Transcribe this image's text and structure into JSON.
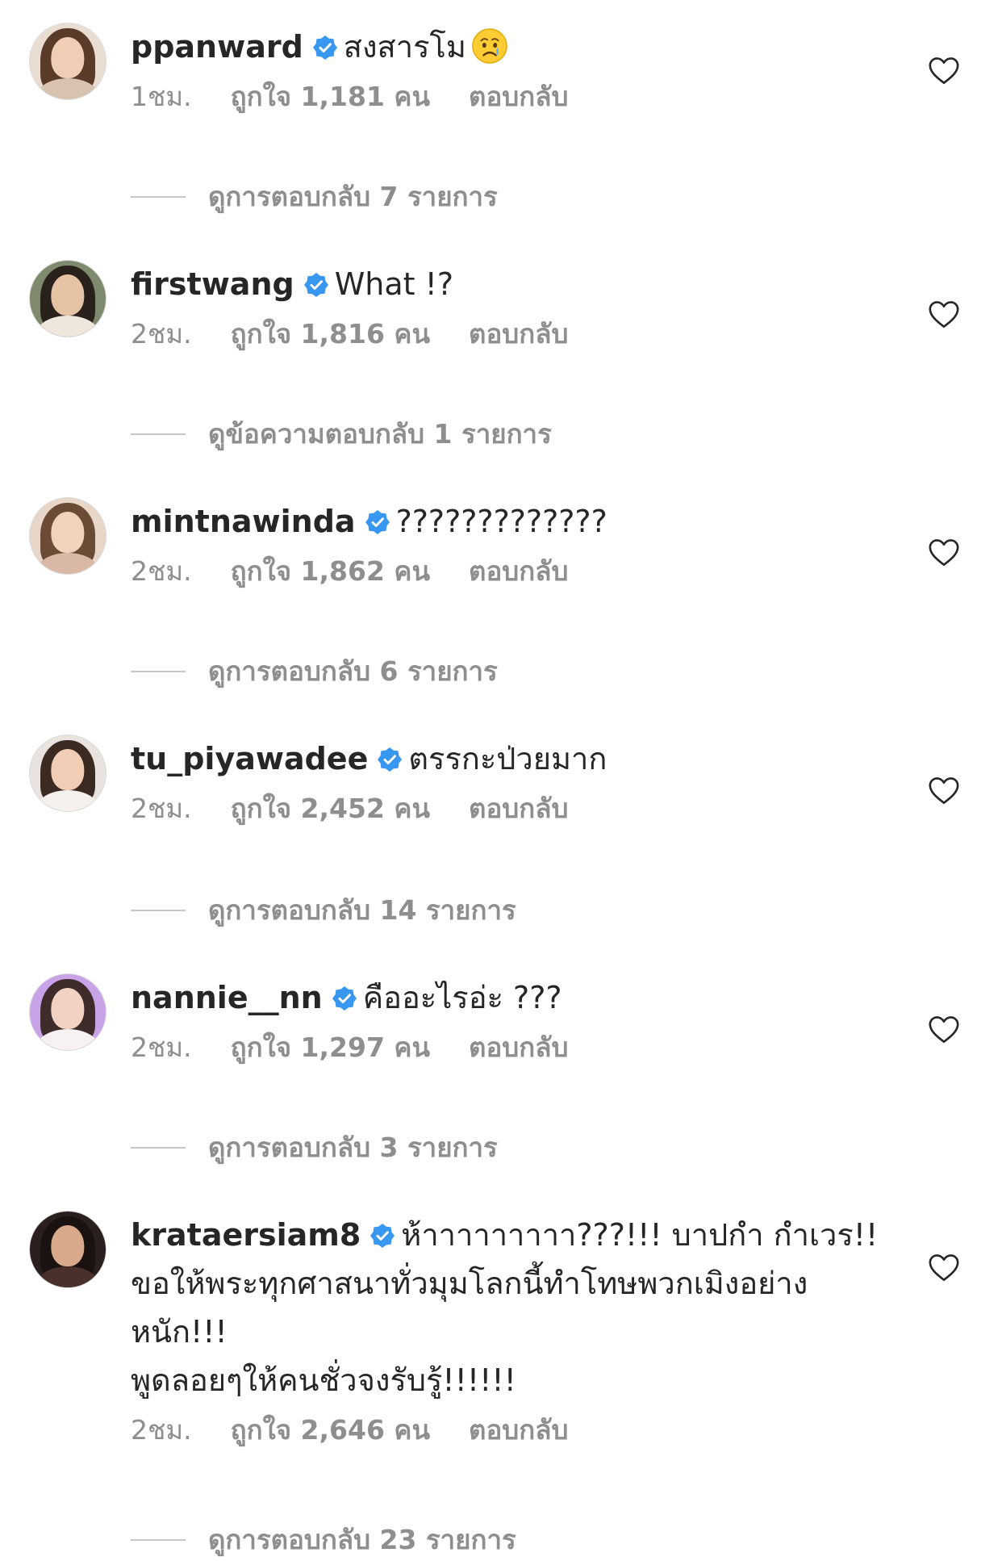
{
  "comments": [
    {
      "username": "ppanward",
      "text": "สงสารโม",
      "emoji": "crying-face",
      "time": "1ชม.",
      "likes": "ถูกใจ 1,181 คน",
      "reply": "ตอบกลับ",
      "view_replies": "ดูการตอบกลับ 7 รายการ",
      "avatar_colors": {
        "bg": "#e9ddd2",
        "hair": "#5a3b2a",
        "face": "#f0cdb4",
        "body": "#d8c2b0"
      }
    },
    {
      "username": "firstwang",
      "text": "What !?",
      "time": "2ชม.",
      "likes": "ถูกใจ 1,816 คน",
      "reply": "ตอบกลับ",
      "view_replies": "ดูข้อความตอบกลับ 1 รายการ",
      "avatar_colors": {
        "bg": "#7d8a6d",
        "hair": "#2b211c",
        "face": "#e7c3a6",
        "body": "#efe6dc"
      }
    },
    {
      "username": "mintnawinda",
      "text": "?????????????",
      "time": "2ชม.",
      "likes": "ถูกใจ 1,862 คน",
      "reply": "ตอบกลับ",
      "view_replies": "ดูการตอบกลับ 6 รายการ",
      "avatar_colors": {
        "bg": "#e8d6c8",
        "hair": "#6b4a36",
        "face": "#f3d2bd",
        "body": "#d9b9a5"
      }
    },
    {
      "username": "tu_piyawadee",
      "text": "ตรรกะป่วยมาก",
      "time": "2ชม.",
      "likes": "ถูกใจ 2,452 คน",
      "reply": "ตอบกลับ",
      "view_replies": "ดูการตอบกลับ 14 รายการ",
      "avatar_colors": {
        "bg": "#e9e3df",
        "hair": "#3b2a22",
        "face": "#f1cdb6",
        "body": "#f4f0ec"
      }
    },
    {
      "username": "nannie__nn",
      "text": "คืออะไรอ่ะ ???",
      "time": "2ชม.",
      "likes": "ถูกใจ 1,297 คน",
      "reply": "ตอบกลับ",
      "view_replies": "ดูการตอบกลับ 3 รายการ",
      "avatar_colors": {
        "bg": "#c9a3e8",
        "hair": "#3e2c2a",
        "face": "#f2d2c2",
        "body": "#f7f1f4"
      }
    },
    {
      "username": "krataersiam8",
      "text": "ห้าาาาาาาาา???!!! บาปกำ กำเวร!!\nขอให้พระทุกศาสนาทั่วมุมโลกนี้ทำโทษพวกเมิงอย่าง\nหนัก!!!\nพูดลอยๆให้คนชั่วจงรับรู้!!!!!!",
      "time": "2ชม.",
      "likes": "ถูกใจ 2,646 คน",
      "reply": "ตอบกลับ",
      "view_replies": "ดูการตอบกลับ 23 รายการ",
      "avatar_colors": {
        "bg": "#2a1f1d",
        "hair": "#1a1210",
        "face": "#d9a98c",
        "body": "#4a302a"
      }
    }
  ],
  "colors": {
    "verified": "#3897f0",
    "text": "#262626",
    "secondary": "#8e8e8e"
  }
}
